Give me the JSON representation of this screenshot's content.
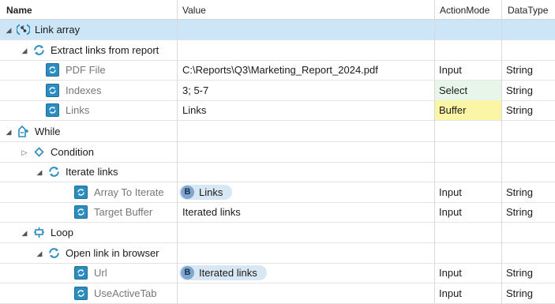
{
  "headers": {
    "name": "Name",
    "value": "Value",
    "action_mode": "ActionMode",
    "data_type": "DataType"
  },
  "rows": [
    {
      "name": "Link array",
      "value": "",
      "mode": "",
      "type": "",
      "icon": "link-array-icon"
    },
    {
      "name": "Extract links from report",
      "value": "",
      "mode": "",
      "type": "",
      "icon": "refresh-icon"
    },
    {
      "name": "PDF File",
      "value": "C:\\Reports\\Q3\\Marketing_Report_2024.pdf",
      "mode": "Input",
      "type": "String",
      "icon": "property-icon"
    },
    {
      "name": "Indexes",
      "value": "3; 5-7",
      "mode": "Select",
      "type": "String",
      "icon": "property-icon"
    },
    {
      "name": "Links",
      "value": "Links",
      "mode": "Buffer",
      "type": "String",
      "icon": "property-icon"
    },
    {
      "name": "While",
      "value": "",
      "mode": "",
      "type": "",
      "icon": "while-icon"
    },
    {
      "name": "Condition",
      "value": "",
      "mode": "",
      "type": "",
      "icon": "diamond-icon"
    },
    {
      "name": "Iterate links",
      "value": "",
      "mode": "",
      "type": "",
      "icon": "refresh-icon"
    },
    {
      "name": "Array To Iterate",
      "value": "Links",
      "badge": "B",
      "mode": "Input",
      "type": "String",
      "icon": "property-icon"
    },
    {
      "name": "Target Buffer",
      "value": "Iterated links",
      "mode": "Input",
      "type": "String",
      "icon": "property-icon"
    },
    {
      "name": "Loop",
      "value": "",
      "mode": "",
      "type": "",
      "icon": "loop-icon"
    },
    {
      "name": "Open link in browser",
      "value": "",
      "mode": "",
      "type": "",
      "icon": "refresh-icon"
    },
    {
      "name": "Url",
      "value": "Iterated links",
      "badge": "B",
      "mode": "Input",
      "type": "String",
      "icon": "property-icon"
    },
    {
      "name": "UseActiveTab",
      "value": "",
      "mode": "Input",
      "type": "String",
      "icon": "property-icon"
    }
  ],
  "colors": {
    "selected_row": "#cde6f7",
    "select_mode": "#e8f6e9",
    "buffer_mode": "#fbf6a6",
    "icon_blue": "#2b8cbf",
    "badge": "#7ea6cf"
  }
}
